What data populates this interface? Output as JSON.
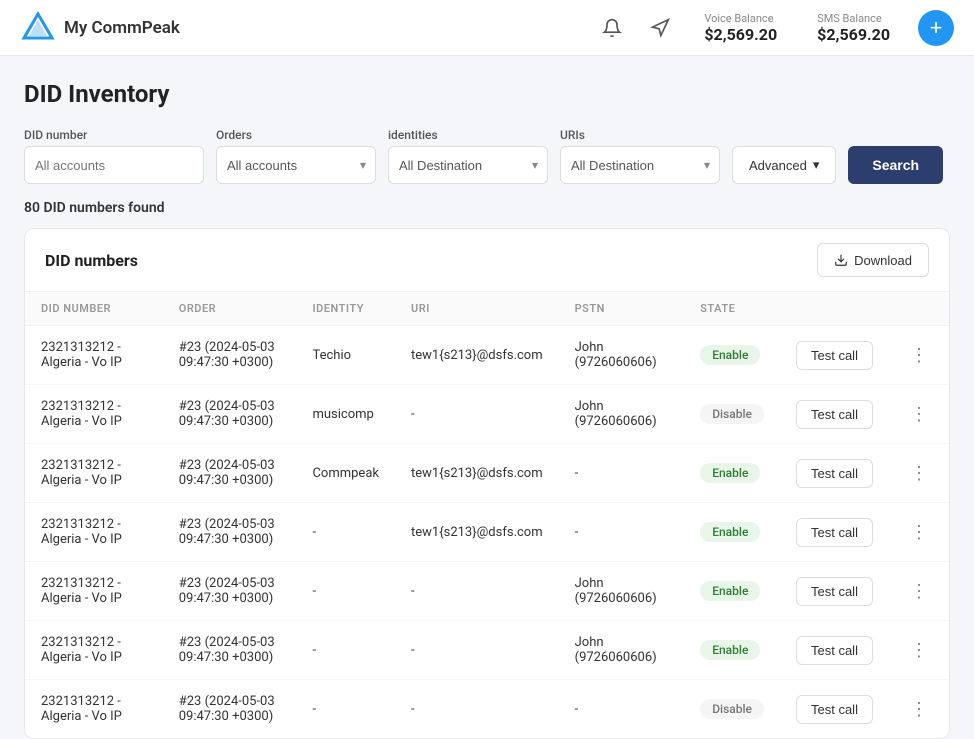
{
  "header": {
    "logo_text": "My CommPeak",
    "voice_balance_label": "Voice Balance",
    "voice_balance_value": "$2,569.20",
    "sms_balance_label": "SMS Balance",
    "sms_balance_value": "$2,569.20"
  },
  "page": {
    "title": "DID Inventory",
    "results_count": "80 DID numbers found"
  },
  "filters": {
    "did_number_label": "DID number",
    "did_number_placeholder": "All accounts",
    "orders_label": "Orders",
    "orders_placeholder": "All accounts",
    "identities_label": "identities",
    "identities_placeholder": "All Destination",
    "uris_label": "URIs",
    "uris_placeholder": "All Destination",
    "advanced_label": "Advanced",
    "search_label": "Search"
  },
  "table": {
    "title": "DID numbers",
    "download_label": "Download",
    "columns": [
      "DID NUMBER",
      "ORDER",
      "IDENTITY",
      "URI",
      "PSTN",
      "STATE",
      "",
      ""
    ],
    "rows": [
      {
        "did_number": "2321313212 - Algeria - Vo IP",
        "order": "#23 (2024-05-03 09:47:30 +0300)",
        "identity": "Techio",
        "uri": "tew1{s213}@dsfs.com",
        "pstn": "John  (9726060606)",
        "state": "Enable",
        "test_call": "Test call"
      },
      {
        "did_number": "2321313212 - Algeria - Vo IP",
        "order": "#23 (2024-05-03 09:47:30 +0300)",
        "identity": "musicomp",
        "uri": "-",
        "pstn": "John (9726060606)",
        "state": "Disable",
        "test_call": "Test call"
      },
      {
        "did_number": "2321313212 - Algeria - Vo IP",
        "order": "#23 (2024-05-03 09:47:30 +0300)",
        "identity": "Commpeak",
        "uri": "tew1{s213}@dsfs.com",
        "pstn": "-",
        "state": "Enable",
        "test_call": "Test call"
      },
      {
        "did_number": "2321313212 - Algeria - Vo IP",
        "order": "#23 (2024-05-03 09:47:30 +0300)",
        "identity": "-",
        "uri": "tew1{s213}@dsfs.com",
        "pstn": "-",
        "state": "Enable",
        "test_call": "Test call"
      },
      {
        "did_number": "2321313212 - Algeria - Vo IP",
        "order": "#23 (2024-05-03 09:47:30 +0300)",
        "identity": "-",
        "uri": "-",
        "pstn": "John  (9726060606)",
        "state": "Enable",
        "test_call": "Test call"
      },
      {
        "did_number": "2321313212 - Algeria - Vo IP",
        "order": "#23 (2024-05-03 09:47:30 +0300)",
        "identity": "-",
        "uri": "-",
        "pstn": "John (9726060606)",
        "state": "Enable",
        "test_call": "Test call"
      },
      {
        "did_number": "2321313212 - Algeria - Vo IP",
        "order": "#23 (2024-05-03 09:47:30 +0300)",
        "identity": "-",
        "uri": "-",
        "pstn": "-",
        "state": "Disable",
        "test_call": "Test call"
      }
    ]
  }
}
